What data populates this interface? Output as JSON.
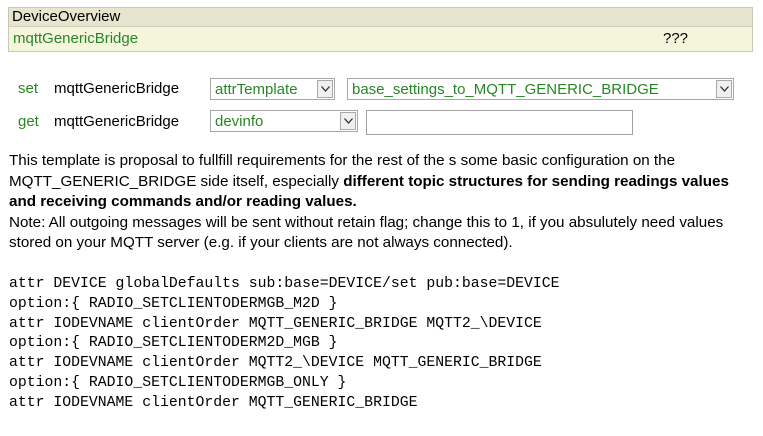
{
  "overview": {
    "header": "DeviceOverview",
    "device_name": "mqttGenericBridge",
    "state": "???"
  },
  "set_row": {
    "command": "set",
    "device": "mqttGenericBridge",
    "attribute_select": "attrTemplate",
    "value_select": "base_settings_to_MQTT_GENERIC_BRIDGE"
  },
  "get_row": {
    "command": "get",
    "device": "mqttGenericBridge",
    "reading_select": "devinfo",
    "value_input": ""
  },
  "description": {
    "intro": "This template is proposal to fullfill requirements for the rest of the s some basic configuration on the MQTT_GENERIC_BRIDGE side itself, especially ",
    "emphasis": "different topic structures for sending readings values and receiving commands and/or reading values.",
    "note": "Note: All outgoing messages will be sent without retain flag; change this to 1, if you absulutely need values stored on your MQTT server (e.g. if your clients are not always connected)."
  },
  "code_lines": [
    "attr DEVICE globalDefaults sub:base=DEVICE/set pub:base=DEVICE",
    "option:{ RADIO_SETCLIENTODERMGB_M2D }",
    "attr IODEVNAME clientOrder MQTT_GENERIC_BRIDGE MQTT2_\\DEVICE",
    "option:{ RADIO_SETCLIENTODERM2D_MGB }",
    "attr IODEVNAME clientOrder MQTT2_\\DEVICE MQTT_GENERIC_BRIDGE",
    "option:{ RADIO_SETCLIENTODERMGB_ONLY }",
    "attr IODEVNAME clientOrder MQTT_GENERIC_BRIDGE"
  ],
  "colors": {
    "link_green": "#278727",
    "panel_bg": "#f5f5dc",
    "panel_header_bg": "#e6e6cf"
  }
}
